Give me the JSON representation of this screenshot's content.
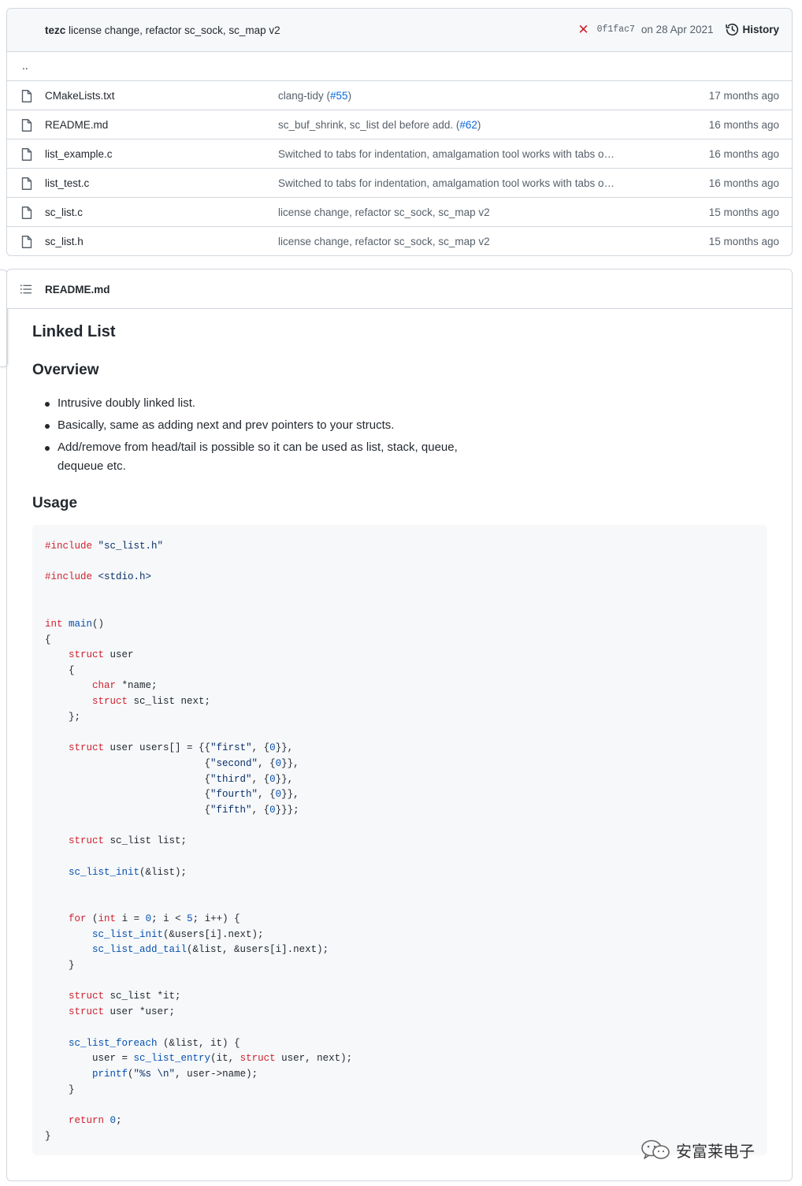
{
  "commit": {
    "author": "tezc",
    "message": "license change, refactor sc_sock, sc_map v2",
    "status_icon": "x-icon",
    "sha": "0f1fac7",
    "date": "on 28 Apr 2021",
    "history_label": "History"
  },
  "parent_link": "..",
  "files": [
    {
      "name": "CMakeLists.txt",
      "commit_text": "clang-tidy (",
      "commit_pr": "#55",
      "commit_tail": ")",
      "age": "17 months ago"
    },
    {
      "name": "README.md",
      "commit_text": "sc_buf_shrink, sc_list del before add. (",
      "commit_pr": "#62",
      "commit_tail": ")",
      "age": "16 months ago"
    },
    {
      "name": "list_example.c",
      "commit_text": "Switched to tabs for indentation, amalgamation tool works with tabs o…",
      "commit_pr": "",
      "commit_tail": "",
      "age": "16 months ago"
    },
    {
      "name": "list_test.c",
      "commit_text": "Switched to tabs for indentation, amalgamation tool works with tabs o…",
      "commit_pr": "",
      "commit_tail": "",
      "age": "16 months ago"
    },
    {
      "name": "sc_list.c",
      "commit_text": "license change, refactor sc_sock, sc_map v2",
      "commit_pr": "",
      "commit_tail": "",
      "age": "15 months ago"
    },
    {
      "name": "sc_list.h",
      "commit_text": "license change, refactor sc_sock, sc_map v2",
      "commit_pr": "",
      "commit_tail": "",
      "age": "15 months ago"
    }
  ],
  "readme": {
    "file_label": "README.md",
    "title": "Linked List",
    "overview_heading": "Overview",
    "bullets": [
      "Intrusive doubly linked list.",
      "Basically, same as adding next and prev pointers to your structs.",
      "Add/remove from head/tail is possible so it can be used as list, stack, queue, dequeue etc."
    ],
    "usage_heading": "Usage"
  },
  "code_lines": [
    "#include \"sc_list.h\"",
    "#include <stdio.h>",
    "int main()",
    "{",
    "    struct user",
    "    {",
    "        char *name;",
    "        struct sc_list next;",
    "    };",
    "    struct user users[] = {{\"first\", {0}},",
    "                           {\"second\", {0}},",
    "                           {\"third\", {0}},",
    "                           {\"fourth\", {0}},",
    "                           {\"fifth\", {0}}};",
    "    struct sc_list list;",
    "    sc_list_init(&list);",
    "    for (int i = 0; i < 5; i++) {",
    "        sc_list_init(&users[i].next);",
    "        sc_list_add_tail(&list, &users[i].next);",
    "    }",
    "    struct sc_list *it;",
    "    struct user *user;",
    "    sc_list_foreach (&list, it) {",
    "        user = sc_list_entry(it, struct user, next);",
    "        printf(\"%s \\n\", user->name);",
    "    }",
    "    return 0;",
    "}"
  ],
  "watermark": "安富莱电子"
}
